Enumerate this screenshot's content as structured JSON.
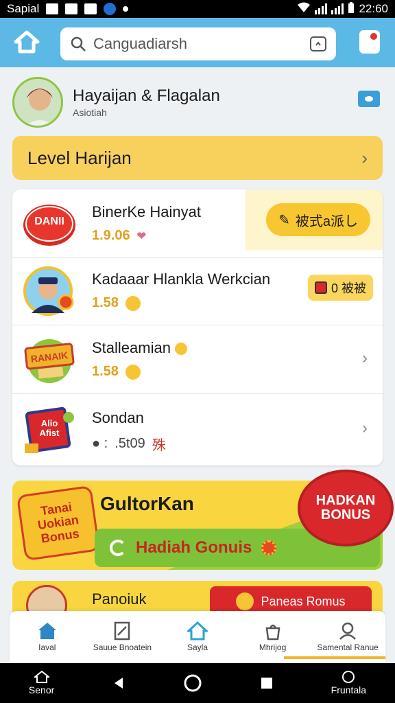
{
  "status_bar": {
    "carrier": "Sapial",
    "time": "22:60"
  },
  "header": {
    "search_placeholder": "Canguadiarsh"
  },
  "profile": {
    "name": "Hayaijan & Flagalan",
    "subtitle": "Asiotiah"
  },
  "level_banner": {
    "label": "Level Harijan"
  },
  "rows": [
    {
      "title": "BinerKe Hainyat",
      "meta": "1.9.06",
      "badge_text": "Danii",
      "action_label": "被式a派し"
    },
    {
      "title": "Kadaaar Hlankla Werkcian",
      "meta": "1.58",
      "action_label": "0 被被"
    },
    {
      "title": "Stalleamian",
      "meta": "1.58",
      "badge_text": "Ranaik"
    },
    {
      "title": "Sondan",
      "meta_prefix": "● :",
      "meta": ".5t09",
      "meta_suffix": "殊",
      "badge_text": "Alio Afist"
    }
  ],
  "bonus_banner": {
    "left_badge": "Tanai Uokian Bonus",
    "title": "GultorKan",
    "button_label": "Hadiah Gonuis",
    "starburst": "HADKAN BONUS"
  },
  "promo": {
    "title": "Panoiuk",
    "button_label": "Paneas Romus"
  },
  "bottom_nav": [
    {
      "label": "Iaval"
    },
    {
      "label": "Sauue Bnoatein"
    },
    {
      "label": "Sayla"
    },
    {
      "label": "Mhrijog"
    },
    {
      "label": "Samental Ranue"
    }
  ],
  "android_bar": {
    "left_label": "Senor",
    "right_label": "Fruntala"
  },
  "colors": {
    "header": "#5cb8e4",
    "accent_yellow": "#f8d15c",
    "accent_red": "#d9282b",
    "accent_green": "#7ec23a"
  }
}
